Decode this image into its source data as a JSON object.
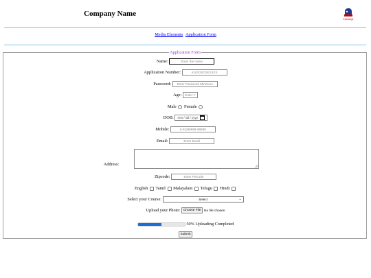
{
  "header": {
    "company_name": "Company Name",
    "logo_text": "Eyerange"
  },
  "nav": {
    "links": [
      "Media Elements",
      "Application Form"
    ]
  },
  "form": {
    "legend": "Application Form",
    "name": {
      "label": "Name:",
      "placeholder": "Enter the name"
    },
    "app_number": {
      "label": "Application Number:",
      "value": "KU2020CSE1XXX"
    },
    "password": {
      "label": "Password:",
      "placeholder": "Enter Password Minimum"
    },
    "age": {
      "label": "Age:",
      "placeholder": "Enter Y"
    },
    "gender": {
      "label": "Male",
      "female_label": "Female"
    },
    "dob": {
      "label": "DOB:",
      "placeholder": "mm / dd / yyyy"
    },
    "mobile": {
      "label": "Mobile:",
      "placeholder": "(+91)99999-99999"
    },
    "email": {
      "label": "Email:",
      "placeholder": "Enter Email"
    },
    "address": {
      "label": "Address:"
    },
    "zipcode": {
      "label": "Zipcode:",
      "placeholder": "Enter Pincode"
    },
    "languages": [
      "English",
      "Tamil",
      "Malayalam",
      "Telugu",
      "Hindi"
    ],
    "course": {
      "label": "Select your Course:",
      "selected": "Select"
    },
    "photo": {
      "label": "Upload your Photo:",
      "button": "Choose File",
      "status": "No file chosen"
    },
    "progress": {
      "value": 0.5,
      "text": "50% Uploading Completed"
    },
    "submit": "Submit"
  },
  "colors": {
    "accent": "#7fbfe6",
    "legend": "#9b30d9",
    "link": "#0000ee",
    "progress": "#1a6fd4"
  }
}
